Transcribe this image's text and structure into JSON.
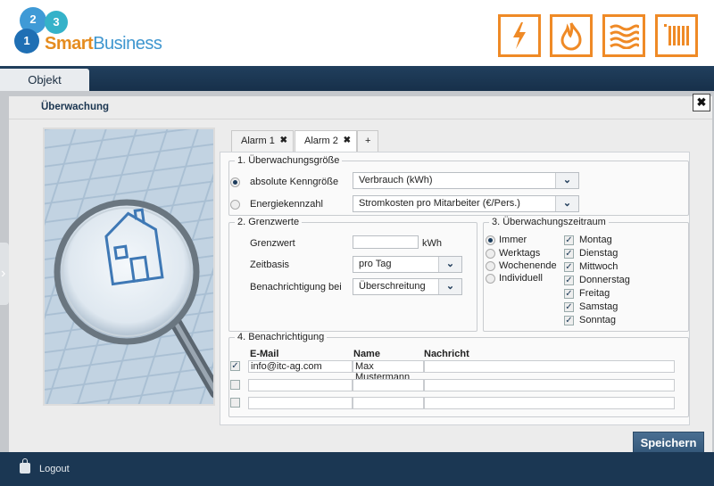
{
  "header": {
    "logo": {
      "n1": "1",
      "n2": "2",
      "n3": "3",
      "brand_smart": "Smart",
      "brand_business": "Business"
    },
    "icons": [
      "lightning-icon",
      "flame-icon",
      "heat-waves-icon",
      "radiator-icon"
    ],
    "accent_color": "#ef8a26"
  },
  "nav": {
    "tab_objekt": "Objekt"
  },
  "panel": {
    "title": "Überwachung",
    "close_label": "✖",
    "tabs": [
      {
        "label": "Alarm 1",
        "close": "✖"
      },
      {
        "label": "Alarm 2",
        "close": "✖"
      },
      {
        "label": "+"
      }
    ],
    "section1": {
      "legend": "1. Überwachungsgröße",
      "option1_label": "absolute Kenngröße",
      "option1_value": "Verbrauch (kWh)",
      "option2_label": "Energiekennzahl",
      "option2_value": "Stromkosten pro Mitarbeiter (€/Pers.)"
    },
    "section2": {
      "legend": "2. Grenzwerte",
      "grenzwert_label": "Grenzwert",
      "grenzwert_value": "",
      "unit": "kWh",
      "zeitbasis_label": "Zeitbasis",
      "zeitbasis_value": "pro Tag",
      "benachrichtigung_label": "Benachrichtigung bei",
      "benachrichtigung_value": "Überschreitung"
    },
    "section3": {
      "legend": "3. Überwachungszeitraum",
      "periods": [
        "Immer",
        "Werktags",
        "Wochenende",
        "Individuell"
      ],
      "days": [
        "Montag",
        "Dienstag",
        "Mittwoch",
        "Donnerstag",
        "Freitag",
        "Samstag",
        "Sonntag"
      ]
    },
    "section4": {
      "legend": "4. Benachrichtigung",
      "col_email": "E-Mail",
      "col_name": "Name",
      "col_message": "Nachricht",
      "rows": [
        {
          "email": "info@itc-ag.com",
          "name": "Max Mustermann",
          "message": ""
        },
        {
          "email": "",
          "name": "",
          "message": ""
        },
        {
          "email": "",
          "name": "",
          "message": ""
        }
      ]
    },
    "save_label": "Speichern"
  },
  "footer": {
    "logout_label": "Logout"
  }
}
